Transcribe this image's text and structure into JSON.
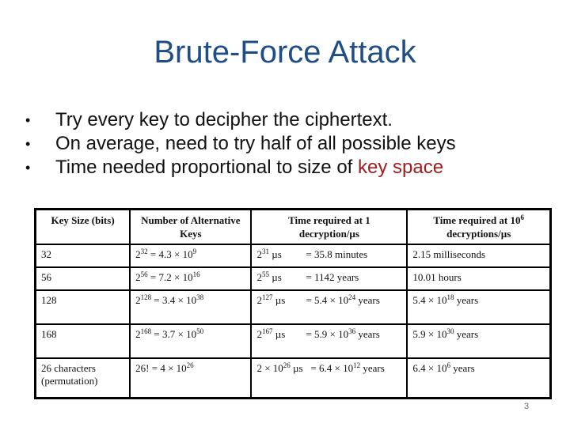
{
  "slide": {
    "title": "Brute-Force Attack",
    "bullets": [
      {
        "text": "Try every key to decipher the ciphertext.",
        "highlight": ""
      },
      {
        "text": "On average, need to try half of all possible keys",
        "highlight": ""
      },
      {
        "text": "Time needed proportional to size of ",
        "highlight": "key space"
      }
    ],
    "bullet_glyph": "•",
    "accent_color": "#a11d1d",
    "title_color": "#1f4e86",
    "page_number": "3"
  },
  "table": {
    "headers": {
      "key_size": "Key Size (bits)",
      "alt_keys_line1": "Number of Alternative",
      "alt_keys_line2": "Keys",
      "time1_line1": "Time required at 1",
      "time1_line2": "decryption/µs",
      "time2_line1_base": "Time required at 10",
      "time2_line1_exp": "6",
      "time2_line2": "decryptions/µs"
    },
    "rows": [
      {
        "key_size": "32",
        "alt_base": "2",
        "alt_exp": "32",
        "alt_eq": " = 4.3 × 10",
        "alt_eq_exp": "9",
        "t1_base": "2",
        "t1_exp": "31",
        "t1_unit": " µs",
        "t1_eq": "= 35.8 minutes",
        "t1_eq_exp": "",
        "t1_eq_tail": "",
        "t2": "2.15 milliseconds",
        "t2_exp": "",
        "t2_tail": ""
      },
      {
        "key_size": "56",
        "alt_base": "2",
        "alt_exp": "56",
        "alt_eq": " = 7.2 × 10",
        "alt_eq_exp": "16",
        "t1_base": "2",
        "t1_exp": "55",
        "t1_unit": " µs",
        "t1_eq": "= 1142 years",
        "t1_eq_exp": "",
        "t1_eq_tail": "",
        "t2": "10.01 hours",
        "t2_exp": "",
        "t2_tail": ""
      },
      {
        "key_size": "128",
        "alt_base": "2",
        "alt_exp": "128",
        "alt_eq": " = 3.4 × 10",
        "alt_eq_exp": "38",
        "t1_base": "2",
        "t1_exp": "127",
        "t1_unit": " µs",
        "t1_eq": "= 5.4 × 10",
        "t1_eq_exp": "24",
        "t1_eq_tail": " years",
        "t2": "5.4 × 10",
        "t2_exp": "18",
        "t2_tail": " years"
      },
      {
        "key_size": "168",
        "alt_base": "2",
        "alt_exp": "168",
        "alt_eq": " = 3.7 × 10",
        "alt_eq_exp": "50",
        "t1_base": "2",
        "t1_exp": "167",
        "t1_unit": " µs",
        "t1_eq": "= 5.9 × 10",
        "t1_eq_exp": "36",
        "t1_eq_tail": " years",
        "t2": "5.9 × 10",
        "t2_exp": "30",
        "t2_tail": " years"
      },
      {
        "key_size_line1": "26 characters",
        "key_size_line2": "(permutation)",
        "alt_base": "26! = 4 × 10",
        "alt_exp": "26",
        "alt_eq": "",
        "alt_eq_exp": "",
        "t1_base": "2 × 10",
        "t1_exp": "26",
        "t1_unit": " µs",
        "t1_eq": "= 6.4 × 10",
        "t1_eq_exp": "12",
        "t1_eq_tail": " years",
        "t2": "6.4 × 10",
        "t2_exp": "6",
        "t2_tail": " years"
      }
    ]
  }
}
